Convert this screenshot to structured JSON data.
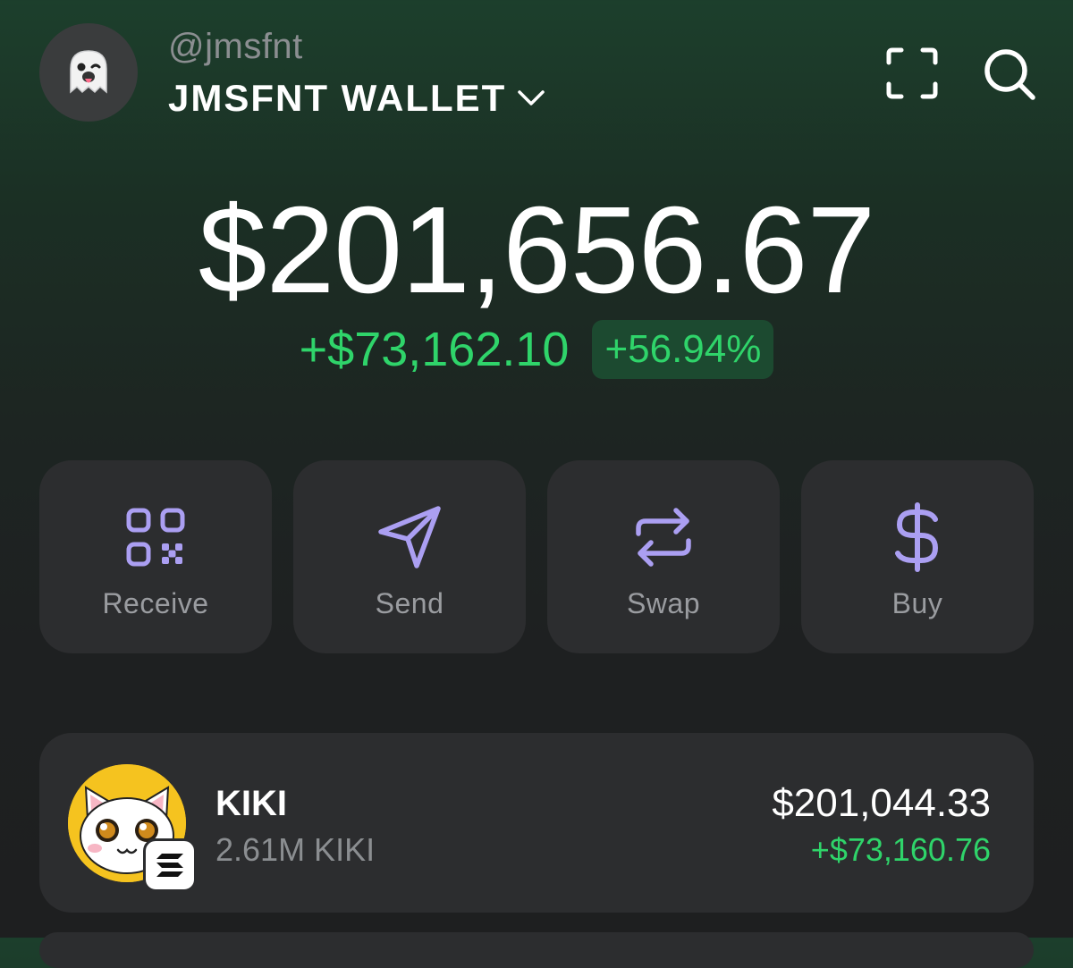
{
  "header": {
    "avatar_icon": "ghost-emoji-icon",
    "handle": "@jmsfnt",
    "wallet_name": "JMSFNT WALLET",
    "dropdown_icon": "chevron-down-icon",
    "scan_icon": "scan-qr-icon",
    "search_icon": "search-icon"
  },
  "balance": {
    "total": "$201,656.67",
    "change_amount": "+$73,162.10",
    "change_percent": "+56.94%"
  },
  "actions": [
    {
      "label": "Receive",
      "icon": "qr-code-icon"
    },
    {
      "label": "Send",
      "icon": "paper-plane-icon"
    },
    {
      "label": "Swap",
      "icon": "swap-arrows-icon"
    },
    {
      "label": "Buy",
      "icon": "dollar-sign-icon"
    }
  ],
  "tokens": [
    {
      "name": "KIKI",
      "amount": "2.61M KIKI",
      "value": "$201,044.33",
      "change": "+$73,160.76",
      "logo_icon": "kiki-cat-logo",
      "chain_icon": "solana-icon"
    }
  ],
  "colors": {
    "positive": "#2fd46a",
    "accent": "#ab9ff2",
    "card_bg": "#2c2d2f",
    "muted_text": "#8b8e91"
  }
}
